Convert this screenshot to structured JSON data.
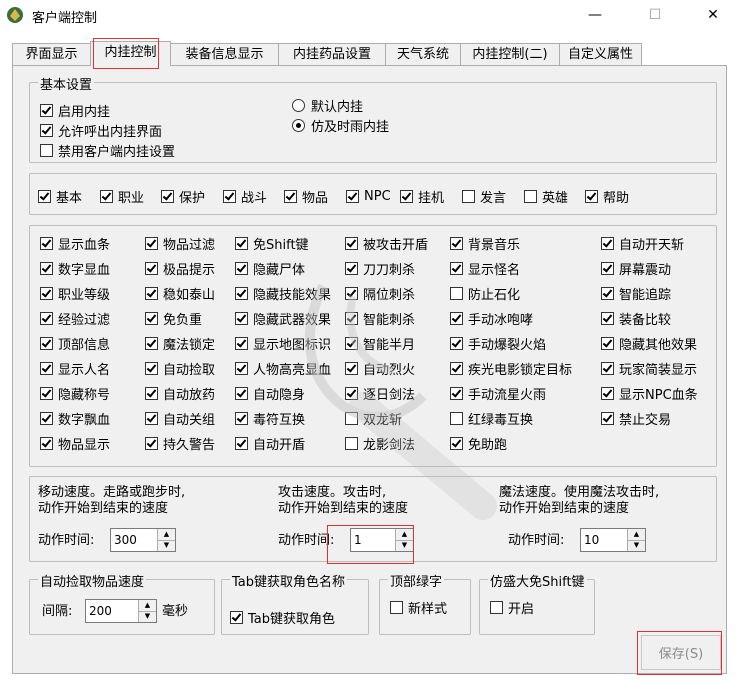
{
  "window": {
    "title": "客户端控制",
    "minimize": "—",
    "maximize": "☐",
    "close": "✕"
  },
  "tabs": [
    {
      "label": "界面显示"
    },
    {
      "label": "内挂控制"
    },
    {
      "label": "装备信息显示"
    },
    {
      "label": "内挂药品设置"
    },
    {
      "label": "天气系统"
    },
    {
      "label": "内挂控制(二)"
    },
    {
      "label": "自定义属性"
    }
  ],
  "basic": {
    "legend": "基本设置",
    "items": [
      {
        "label": "启用内挂",
        "checked": true
      },
      {
        "label": "允许呼出内挂界面",
        "checked": true
      },
      {
        "label": "禁用客户端内挂设置",
        "checked": false
      }
    ],
    "radios": [
      {
        "label": "默认内挂",
        "selected": false
      },
      {
        "label": "仿及时雨内挂",
        "selected": true
      }
    ]
  },
  "categories": [
    {
      "label": "基本",
      "checked": true
    },
    {
      "label": "职业",
      "checked": true
    },
    {
      "label": "保护",
      "checked": true
    },
    {
      "label": "战斗",
      "checked": true
    },
    {
      "label": "物品",
      "checked": true
    },
    {
      "label": "NPC",
      "checked": true
    },
    {
      "label": "挂机",
      "checked": true
    },
    {
      "label": "发言",
      "checked": false
    },
    {
      "label": "英雄",
      "checked": false
    },
    {
      "label": "帮助",
      "checked": true
    }
  ],
  "options": [
    [
      {
        "label": "显示血条",
        "checked": true
      },
      {
        "label": "数字显血",
        "checked": true
      },
      {
        "label": "职业等级",
        "checked": true
      },
      {
        "label": "经验过滤",
        "checked": true
      },
      {
        "label": "顶部信息",
        "checked": true
      },
      {
        "label": "显示人名",
        "checked": true
      },
      {
        "label": "隐藏称号",
        "checked": true
      },
      {
        "label": "数字飘血",
        "checked": true
      },
      {
        "label": "物品显示",
        "checked": true
      }
    ],
    [
      {
        "label": "物品过滤",
        "checked": true
      },
      {
        "label": "极品提示",
        "checked": true
      },
      {
        "label": "稳如泰山",
        "checked": true
      },
      {
        "label": "免负重",
        "checked": true
      },
      {
        "label": "魔法锁定",
        "checked": true
      },
      {
        "label": "自动捡取",
        "checked": true
      },
      {
        "label": "自动放药",
        "checked": true
      },
      {
        "label": "自动关组",
        "checked": true
      },
      {
        "label": "持久警告",
        "checked": true
      }
    ],
    [
      {
        "label": "免Shift键",
        "checked": true
      },
      {
        "label": "隐藏尸体",
        "checked": true
      },
      {
        "label": "隐藏技能效果",
        "checked": true
      },
      {
        "label": "隐藏武器效果",
        "checked": true
      },
      {
        "label": "显示地图标识",
        "checked": true
      },
      {
        "label": "人物高亮显血",
        "checked": true
      },
      {
        "label": "自动隐身",
        "checked": true
      },
      {
        "label": "毒符互换",
        "checked": true
      },
      {
        "label": "自动开盾",
        "checked": true
      }
    ],
    [
      {
        "label": "被攻击开盾",
        "checked": true
      },
      {
        "label": "刀刀刺杀",
        "checked": true
      },
      {
        "label": "隔位刺杀",
        "checked": true
      },
      {
        "label": "智能刺杀",
        "checked": true
      },
      {
        "label": "智能半月",
        "checked": true
      },
      {
        "label": "自动烈火",
        "checked": true
      },
      {
        "label": "逐日剑法",
        "checked": true
      },
      {
        "label": "双龙斩",
        "checked": false
      },
      {
        "label": "龙影剑法",
        "checked": false
      }
    ],
    [
      {
        "label": "背景音乐",
        "checked": true
      },
      {
        "label": "显示怪名",
        "checked": true
      },
      {
        "label": "防止石化",
        "checked": false
      },
      {
        "label": "手动冰咆哮",
        "checked": true
      },
      {
        "label": "手动爆裂火焰",
        "checked": true
      },
      {
        "label": "疾光电影锁定目标",
        "checked": true
      },
      {
        "label": "手动流星火雨",
        "checked": true
      },
      {
        "label": "红绿毒互换",
        "checked": false
      },
      {
        "label": "免助跑",
        "checked": true
      }
    ],
    [
      {
        "label": "自动开天斩",
        "checked": true
      },
      {
        "label": "屏幕震动",
        "checked": true
      },
      {
        "label": "智能追踪",
        "checked": true
      },
      {
        "label": "装备比较",
        "checked": true
      },
      {
        "label": "隐藏其他效果",
        "checked": true
      },
      {
        "label": "玩家简装显示",
        "checked": true
      },
      {
        "label": "显示NPC血条",
        "checked": true
      },
      {
        "label": "禁止交易",
        "checked": true
      }
    ]
  ],
  "speed": {
    "move": {
      "desc1": "移动速度。走路或跑步时,",
      "desc2": "动作开始到结束的速度",
      "label": "动作时间:",
      "value": "300"
    },
    "attack": {
      "desc1": "攻击速度。攻击时,",
      "desc2": "动作开始到结束的速度",
      "label": "动作时间:",
      "value": "1"
    },
    "magic": {
      "desc1": "魔法速度。使用魔法攻击时,",
      "desc2": "动作开始到结束的速度",
      "label": "动作时间:",
      "value": "10"
    }
  },
  "pickup": {
    "legend": "自动捡取物品速度",
    "label": "间隔:",
    "value": "200",
    "unit": "毫秒"
  },
  "tabkey": {
    "legend": "Tab键获取角色名称",
    "label": "Tab键获取角色",
    "checked": true
  },
  "topgreen": {
    "legend": "顶部绿字",
    "label": "新样式",
    "checked": false
  },
  "shift": {
    "legend": "仿盛大免Shift键",
    "label": "开启",
    "checked": false
  },
  "save": {
    "label": "保存(S)"
  },
  "spin_up": "▲",
  "spin_down": "▼"
}
